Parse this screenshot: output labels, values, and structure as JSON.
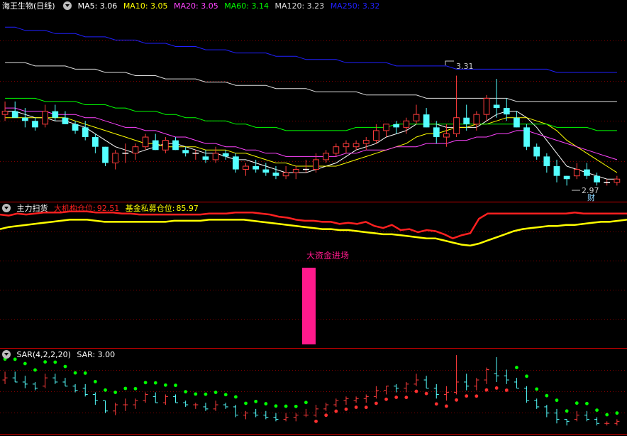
{
  "main": {
    "title": "海王生物(日线)",
    "ma": [
      {
        "label": "MA5: 3.06",
        "color": "#ffffff"
      },
      {
        "label": "MA10: 3.05",
        "color": "#ffff00"
      },
      {
        "label": "MA20: 3.05",
        "color": "#ff44ff"
      },
      {
        "label": "MA60: 3.14",
        "color": "#00ff00"
      },
      {
        "label": "MA120: 3.23",
        "color": "#dddddd"
      },
      {
        "label": "MA250: 3.32",
        "color": "#2020ff"
      }
    ],
    "high_label": "3.31",
    "low_label": "2.97",
    "fin_label": "财"
  },
  "capital": {
    "title": "主力扫货",
    "inst_label": "大机构仓位:",
    "inst_value": "92.51",
    "fund_label": "基金私募仓位:",
    "fund_value": "85.97",
    "signal_label": "大资金进场",
    "colors": {
      "inst": "#ff2020",
      "fund": "#ffff00",
      "signal": "#ff1a8c"
    }
  },
  "sar": {
    "title": "SAR(4,2,2,20)",
    "value_label": "SAR: 3.00",
    "colors": {
      "up": "#ff3030",
      "down": "#00ff00"
    }
  },
  "colors": {
    "up_candle": "#ff3c3c",
    "down_candle": "#54ffff",
    "grid": "#800000",
    "border": "#c80000"
  },
  "chart_data": {
    "type": "candlestick",
    "candles": [
      [
        3.19,
        3.23,
        3.17,
        3.2
      ],
      [
        3.2,
        3.23,
        3.18,
        3.18
      ],
      [
        3.18,
        3.21,
        3.15,
        3.17
      ],
      [
        3.17,
        3.18,
        3.14,
        3.15
      ],
      [
        3.16,
        3.22,
        3.15,
        3.2
      ],
      [
        3.2,
        3.22,
        3.17,
        3.18
      ],
      [
        3.18,
        3.2,
        3.16,
        3.16
      ],
      [
        3.16,
        3.17,
        3.13,
        3.14
      ],
      [
        3.15,
        3.17,
        3.11,
        3.12
      ],
      [
        3.12,
        3.13,
        3.07,
        3.09
      ],
      [
        3.09,
        3.09,
        3.03,
        3.04
      ],
      [
        3.04,
        3.08,
        3.02,
        3.07
      ],
      [
        3.07,
        3.1,
        3.04,
        3.07
      ],
      [
        3.07,
        3.1,
        3.05,
        3.09
      ],
      [
        3.09,
        3.13,
        3.08,
        3.12
      ],
      [
        3.11,
        3.13,
        3.08,
        3.08
      ],
      [
        3.08,
        3.12,
        3.07,
        3.11
      ],
      [
        3.11,
        3.12,
        3.08,
        3.08
      ],
      [
        3.08,
        3.09,
        3.06,
        3.07
      ],
      [
        3.07,
        3.08,
        3.05,
        3.07
      ],
      [
        3.06,
        3.08,
        3.04,
        3.05
      ],
      [
        3.05,
        3.09,
        3.04,
        3.07
      ],
      [
        3.07,
        3.08,
        3.05,
        3.06
      ],
      [
        3.06,
        3.07,
        3.01,
        3.02
      ],
      [
        3.02,
        3.04,
        3.0,
        3.03
      ],
      [
        3.03,
        3.05,
        3.01,
        3.02
      ],
      [
        3.02,
        3.04,
        3.0,
        3.01
      ],
      [
        3.01,
        3.03,
        2.99,
        3.0
      ],
      [
        3.0,
        3.03,
        2.99,
        3.01
      ],
      [
        3.01,
        3.03,
        2.99,
        3.02
      ],
      [
        3.02,
        3.05,
        3.01,
        3.02
      ],
      [
        3.02,
        3.07,
        3.01,
        3.05
      ],
      [
        3.05,
        3.08,
        3.04,
        3.07
      ],
      [
        3.07,
        3.1,
        3.06,
        3.09
      ],
      [
        3.09,
        3.11,
        3.07,
        3.1
      ],
      [
        3.09,
        3.11,
        3.08,
        3.1
      ],
      [
        3.1,
        3.12,
        3.08,
        3.11
      ],
      [
        3.11,
        3.16,
        3.1,
        3.14
      ],
      [
        3.14,
        3.16,
        3.12,
        3.16
      ],
      [
        3.16,
        3.17,
        3.13,
        3.15
      ],
      [
        3.15,
        3.18,
        3.13,
        3.17
      ],
      [
        3.17,
        3.22,
        3.16,
        3.19
      ],
      [
        3.19,
        3.21,
        3.15,
        3.15
      ],
      [
        3.15,
        3.17,
        3.1,
        3.12
      ],
      [
        3.12,
        3.16,
        3.09,
        3.13
      ],
      [
        3.13,
        3.31,
        3.12,
        3.18
      ],
      [
        3.18,
        3.22,
        3.14,
        3.16
      ],
      [
        3.16,
        3.2,
        3.14,
        3.19
      ],
      [
        3.19,
        3.25,
        3.17,
        3.24
      ],
      [
        3.22,
        3.3,
        3.18,
        3.21
      ],
      [
        3.21,
        3.24,
        3.17,
        3.19
      ],
      [
        3.18,
        3.2,
        3.15,
        3.15
      ],
      [
        3.15,
        3.16,
        3.08,
        3.09
      ],
      [
        3.09,
        3.1,
        3.05,
        3.06
      ],
      [
        3.06,
        3.07,
        3.01,
        3.03
      ],
      [
        3.03,
        3.05,
        2.98,
        3.0
      ],
      [
        3.0,
        3.0,
        2.97,
        2.99
      ],
      [
        3.0,
        3.04,
        2.99,
        3.02
      ],
      [
        3.02,
        3.04,
        2.99,
        3.0
      ],
      [
        3.0,
        3.01,
        2.97,
        2.98
      ],
      [
        2.98,
        2.99,
        2.97,
        2.98
      ],
      [
        2.98,
        3.0,
        2.97,
        2.99
      ]
    ],
    "ma": {
      "MA5": [
        3.2,
        3.2,
        3.19,
        3.18,
        3.18,
        3.17,
        3.17,
        3.16,
        3.15,
        3.13,
        3.11,
        3.09,
        3.08,
        3.07,
        3.08,
        3.09,
        3.1,
        3.1,
        3.09,
        3.08,
        3.07,
        3.07,
        3.06,
        3.05,
        3.05,
        3.04,
        3.03,
        3.02,
        3.01,
        3.01,
        3.01,
        3.02,
        3.03,
        3.04,
        3.06,
        3.08,
        3.09,
        3.1,
        3.12,
        3.13,
        3.14,
        3.16,
        3.16,
        3.16,
        3.15,
        3.15,
        3.15,
        3.15,
        3.17,
        3.19,
        3.2,
        3.2,
        3.18,
        3.15,
        3.11,
        3.07,
        3.03,
        3.02,
        3.01,
        3.0,
        2.99,
        2.99
      ],
      "MA10": [
        3.18,
        3.18,
        3.18,
        3.18,
        3.18,
        3.18,
        3.18,
        3.17,
        3.16,
        3.15,
        3.14,
        3.13,
        3.12,
        3.11,
        3.1,
        3.1,
        3.09,
        3.09,
        3.09,
        3.09,
        3.08,
        3.08,
        3.08,
        3.07,
        3.07,
        3.06,
        3.05,
        3.04,
        3.04,
        3.03,
        3.03,
        3.03,
        3.03,
        3.03,
        3.04,
        3.05,
        3.06,
        3.07,
        3.08,
        3.09,
        3.1,
        3.12,
        3.13,
        3.13,
        3.14,
        3.15,
        3.15,
        3.16,
        3.16,
        3.17,
        3.18,
        3.18,
        3.18,
        3.17,
        3.16,
        3.14,
        3.11,
        3.09,
        3.07,
        3.05,
        3.03,
        3.01
      ],
      "MA20": [
        3.21,
        3.21,
        3.2,
        3.2,
        3.2,
        3.19,
        3.19,
        3.19,
        3.18,
        3.18,
        3.17,
        3.16,
        3.15,
        3.15,
        3.14,
        3.14,
        3.13,
        3.12,
        3.12,
        3.11,
        3.1,
        3.1,
        3.09,
        3.09,
        3.08,
        3.08,
        3.07,
        3.07,
        3.06,
        3.06,
        3.06,
        3.06,
        3.06,
        3.06,
        3.07,
        3.07,
        3.08,
        3.08,
        3.08,
        3.09,
        3.09,
        3.09,
        3.1,
        3.1,
        3.1,
        3.11,
        3.11,
        3.12,
        3.12,
        3.13,
        3.13,
        3.14,
        3.14,
        3.13,
        3.12,
        3.11,
        3.1,
        3.09,
        3.08,
        3.07,
        3.06,
        3.05
      ],
      "MA60": [
        3.24,
        3.24,
        3.24,
        3.24,
        3.23,
        3.23,
        3.23,
        3.23,
        3.22,
        3.22,
        3.22,
        3.21,
        3.21,
        3.2,
        3.2,
        3.2,
        3.19,
        3.19,
        3.18,
        3.18,
        3.17,
        3.17,
        3.17,
        3.16,
        3.16,
        3.15,
        3.15,
        3.15,
        3.14,
        3.14,
        3.14,
        3.14,
        3.14,
        3.14,
        3.14,
        3.15,
        3.15,
        3.15,
        3.15,
        3.16,
        3.16,
        3.16,
        3.16,
        3.16,
        3.16,
        3.16,
        3.16,
        3.16,
        3.16,
        3.16,
        3.16,
        3.16,
        3.16,
        3.16,
        3.16,
        3.15,
        3.15,
        3.15,
        3.15,
        3.14,
        3.14,
        3.14
      ],
      "MA120": [
        3.35,
        3.35,
        3.35,
        3.34,
        3.34,
        3.34,
        3.34,
        3.33,
        3.33,
        3.33,
        3.32,
        3.32,
        3.32,
        3.31,
        3.31,
        3.31,
        3.3,
        3.3,
        3.3,
        3.3,
        3.29,
        3.29,
        3.29,
        3.28,
        3.28,
        3.28,
        3.28,
        3.27,
        3.27,
        3.27,
        3.27,
        3.26,
        3.26,
        3.26,
        3.26,
        3.26,
        3.25,
        3.25,
        3.25,
        3.25,
        3.25,
        3.25,
        3.24,
        3.24,
        3.24,
        3.24,
        3.24,
        3.24,
        3.24,
        3.24,
        3.24,
        3.23,
        3.23,
        3.23,
        3.23,
        3.23,
        3.23,
        3.23,
        3.23,
        3.23,
        3.23,
        3.23
      ],
      "MA250": [
        3.46,
        3.46,
        3.45,
        3.45,
        3.45,
        3.44,
        3.44,
        3.44,
        3.43,
        3.43,
        3.43,
        3.42,
        3.42,
        3.42,
        3.41,
        3.41,
        3.41,
        3.4,
        3.4,
        3.4,
        3.39,
        3.39,
        3.39,
        3.38,
        3.38,
        3.38,
        3.38,
        3.37,
        3.37,
        3.37,
        3.36,
        3.36,
        3.36,
        3.36,
        3.35,
        3.35,
        3.35,
        3.35,
        3.35,
        3.34,
        3.34,
        3.34,
        3.34,
        3.34,
        3.34,
        3.33,
        3.33,
        3.33,
        3.33,
        3.33,
        3.33,
        3.33,
        3.33,
        3.33,
        3.33,
        3.32,
        3.32,
        3.32,
        3.32,
        3.32,
        3.32,
        3.32
      ]
    },
    "ylim": [
      2.94,
      3.5
    ],
    "capital": {
      "inst": [
        91,
        90,
        92,
        91,
        92,
        93,
        93,
        93,
        94,
        94,
        94,
        93,
        93,
        93,
        92,
        92,
        91,
        91,
        91,
        91,
        91,
        91,
        91,
        91,
        92,
        92,
        92,
        93,
        93,
        93,
        92,
        91,
        89,
        88,
        86,
        85,
        85,
        84,
        84,
        82,
        83,
        82,
        84,
        80,
        78,
        81,
        76,
        77,
        74,
        76,
        75,
        72,
        68,
        71,
        73,
        87,
        92,
        92,
        92,
        92,
        92,
        92,
        92,
        92,
        92,
        92,
        93,
        92,
        92,
        92,
        92,
        92,
        92
      ],
      "fund": [
        77,
        79,
        80,
        81,
        82,
        83,
        84,
        85,
        86,
        86,
        86,
        85,
        84,
        84,
        84,
        84,
        84,
        84,
        84,
        84,
        85,
        85,
        85,
        85,
        86,
        86,
        86,
        86,
        86,
        85,
        84,
        83,
        82,
        81,
        80,
        79,
        78,
        77,
        77,
        76,
        76,
        75,
        74,
        73,
        72,
        72,
        71,
        70,
        69,
        68,
        68,
        66,
        64,
        62,
        61,
        63,
        66,
        69,
        72,
        75,
        77,
        78,
        79,
        80,
        80,
        81,
        81,
        82,
        83,
        84,
        84,
        85,
        86
      ],
      "ylim": [
        0,
        100
      ]
    },
    "signal_bar": {
      "value": 1
    }
  }
}
